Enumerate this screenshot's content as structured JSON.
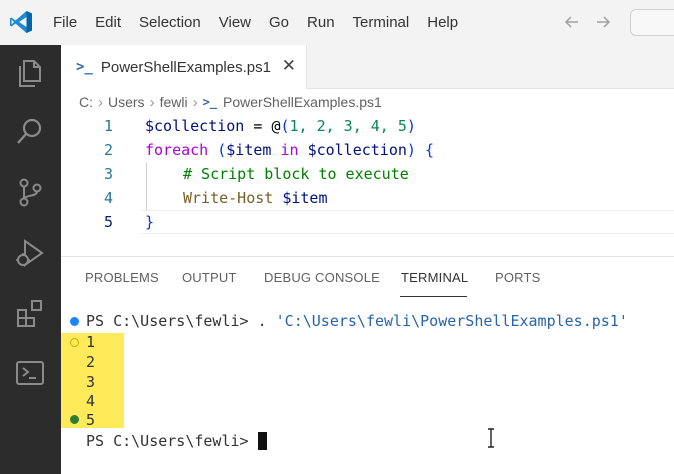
{
  "menu": [
    "File",
    "Edit",
    "Selection",
    "View",
    "Go",
    "Run",
    "Terminal",
    "Help"
  ],
  "tab": {
    "label": "PowerShellExamples.ps1",
    "close": "✕",
    "icon_glyph": ">_"
  },
  "breadcrumb": [
    "C:",
    "Users",
    "fewli",
    "PowerShellExamples.ps1"
  ],
  "editor": {
    "line_numbers": [
      "1",
      "2",
      "3",
      "4",
      "5"
    ],
    "line1": {
      "var": "$collection",
      "eq": " = ",
      "at": "@",
      "open": "(",
      "nums": "1, 2, 3, 4, 5",
      "close": ")"
    },
    "line2": {
      "kw": "foreach",
      "sp": " ",
      "open": "(",
      "var1": "$item",
      "in": " in ",
      "var2": "$collection",
      "close": ")",
      "brace": " {"
    },
    "line3": {
      "comment": "# Script block to execute"
    },
    "line4": {
      "fn": "Write-Host",
      "var": " $item"
    },
    "line5": {
      "brace": "}"
    }
  },
  "panel": {
    "tabs": [
      "PROBLEMS",
      "OUTPUT",
      "DEBUG CONSOLE",
      "TERMINAL",
      "PORTS"
    ],
    "active_tab": "TERMINAL"
  },
  "terminal": {
    "prompt1": "PS C:\\Users\\fewli> . ",
    "command_arg": "'C:\\Users\\fewli\\PowerShellExamples.ps1'",
    "outputs": [
      "1",
      "2",
      "3",
      "4",
      "5"
    ],
    "prompt2": "PS C:\\Users\\fewli> "
  },
  "colors": {
    "activity_bar": "#2c2c2c",
    "highlight": "#ffea5a",
    "accent_blue": "#0065a9"
  }
}
